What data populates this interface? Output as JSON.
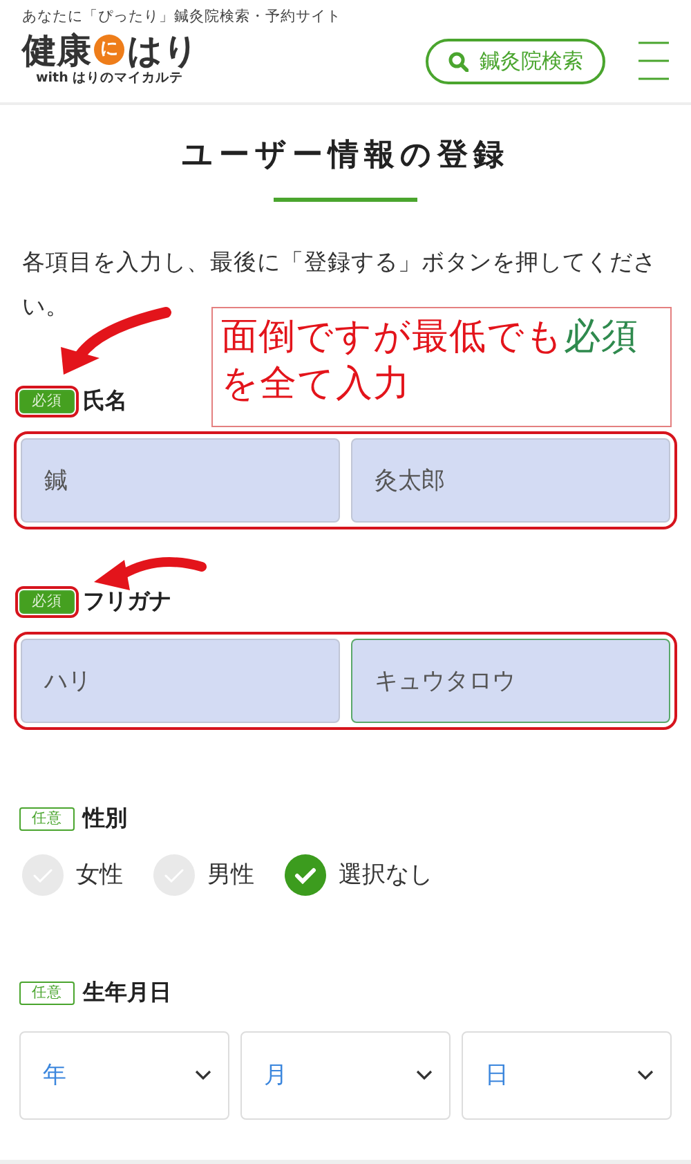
{
  "header": {
    "tagline": "あなたに「ぴったり」鍼灸院検索・予約サイト",
    "logo": {
      "before": "健康",
      "circle": "に",
      "after": "はり",
      "subtitle": "with はりのマイカルテ"
    },
    "search_button": "鍼灸院検索"
  },
  "page_title": "ユーザー情報の登録",
  "intro": "各項目を入力し、最後に「登録する」ボタンを押してください。",
  "sections": [
    {
      "kind": "text",
      "tag": {
        "label": "必須",
        "kind": "required",
        "highlighted": true
      },
      "label": "氏名",
      "highlighted": true,
      "inputs": [
        {
          "value": "鍼",
          "focused": false
        },
        {
          "value": "灸太郎",
          "focused": false
        }
      ]
    },
    {
      "kind": "text",
      "tag": {
        "label": "必須",
        "kind": "required",
        "highlighted": true
      },
      "label": "フリガナ",
      "highlighted": true,
      "inputs": [
        {
          "value": "ハリ",
          "focused": false
        },
        {
          "value": "キュウタロウ",
          "focused": true
        }
      ]
    },
    {
      "kind": "radio",
      "tag": {
        "label": "任意",
        "kind": "optional",
        "highlighted": false
      },
      "label": "性別",
      "options": [
        {
          "label": "女性",
          "selected": false
        },
        {
          "label": "男性",
          "selected": false
        },
        {
          "label": "選択なし",
          "selected": true
        }
      ]
    },
    {
      "kind": "select",
      "tag": {
        "label": "任意",
        "kind": "optional",
        "highlighted": false
      },
      "label": "生年月日",
      "selects": [
        {
          "placeholder": "年"
        },
        {
          "placeholder": "月"
        },
        {
          "placeholder": "日"
        }
      ]
    }
  ],
  "annotation": {
    "segments": [
      {
        "text": "面倒ですが最低でも",
        "color": "#e3141b"
      },
      {
        "text": "必須",
        "color": "#2f8a4e"
      },
      {
        "text": "を全て入力",
        "color": "#e3141b"
      }
    ]
  }
}
